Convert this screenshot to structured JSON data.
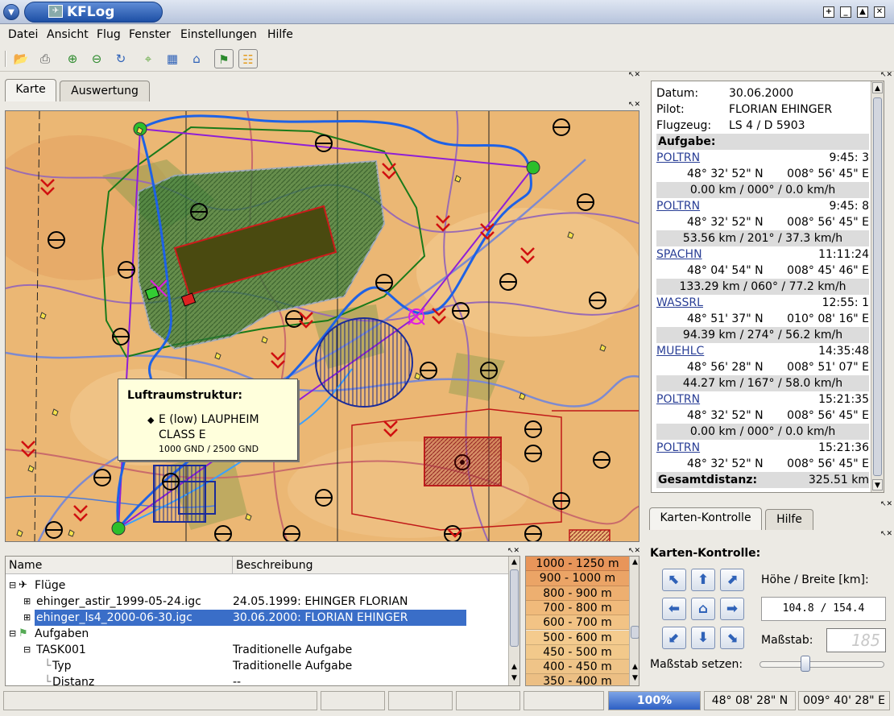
{
  "window": {
    "title": "KFLog"
  },
  "menu": [
    "Datei",
    "Ansicht",
    "Flug",
    "Fenster",
    "Einstellungen",
    "Hilfe"
  ],
  "tabs_main": [
    "Karte",
    "Auswertung"
  ],
  "tooltip": {
    "title": "Luftraumstruktur:",
    "line1": "E (low) LAUPHEIM",
    "line2": "CLASS E",
    "line3": "1000 GND / 2500 GND"
  },
  "flight_info": {
    "datum_label": "Datum:",
    "datum_value": "30.06.2000",
    "pilot_label": "Pilot:",
    "pilot_value": "FLORIAN EHINGER",
    "flugzeug_label": "Flugzeug:",
    "flugzeug_value": "LS 4 / D 5903",
    "aufgabe_label": "Aufgabe:",
    "waypoints": [
      {
        "name": "POLTRN",
        "time": "9:45: 3",
        "coords_n": "48° 32' 52\" N",
        "coords_e": "008° 56' 45\" E",
        "leg": "0.00 km / 000° / 0.0 km/h"
      },
      {
        "name": "POLTRN",
        "time": "9:45: 8",
        "coords_n": "48° 32' 52\" N",
        "coords_e": "008° 56' 45\" E",
        "leg": "53.56 km / 201° / 37.3 km/h"
      },
      {
        "name": "SPACHN",
        "time": "11:11:24",
        "coords_n": "48° 04' 54\" N",
        "coords_e": "008° 45' 46\" E",
        "leg": "133.29 km / 060° / 77.2 km/h"
      },
      {
        "name": "WASSRL",
        "time": "12:55: 1",
        "coords_n": "48° 51' 37\" N",
        "coords_e": "010° 08' 16\" E",
        "leg": "94.39 km / 274° / 56.2 km/h"
      },
      {
        "name": "MUEHLC",
        "time": "14:35:48",
        "coords_n": "48° 56' 28\" N",
        "coords_e": "008° 51' 07\" E",
        "leg": "44.27 km / 167° / 58.0 km/h"
      },
      {
        "name": "POLTRN",
        "time": "15:21:35",
        "coords_n": "48° 32' 52\" N",
        "coords_e": "008° 56' 45\" E",
        "leg": "0.00 km / 000° / 0.0 km/h"
      },
      {
        "name": "POLTRN",
        "time": "15:21:36",
        "coords_n": "48° 32' 52\" N",
        "coords_e": "008° 56' 45\" E",
        "leg": ""
      }
    ],
    "gesamt_label": "Gesamtdistanz:",
    "gesamt_value": "325.51 km"
  },
  "tabs_right": [
    "Karten-Kontrolle",
    "Hilfe"
  ],
  "tree": {
    "col_name": "Name",
    "col_desc": "Beschreibung",
    "rows": [
      {
        "name": "Flüge",
        "desc": ""
      },
      {
        "name": "ehinger_astir_1999-05-24.igc",
        "desc": "24.05.1999: EHINGER FLORIAN"
      },
      {
        "name": "ehinger_ls4_2000-06-30.igc",
        "desc": "30.06.2000: FLORIAN EHINGER"
      },
      {
        "name": "Aufgaben",
        "desc": ""
      },
      {
        "name": "TASK001",
        "desc": "Traditionelle Aufgabe"
      },
      {
        "name": "Typ",
        "desc": "Traditionelle Aufgabe"
      },
      {
        "name": "Distanz",
        "desc": "--"
      }
    ]
  },
  "legend": [
    {
      "label": "1000 - 1250 m",
      "color": "#e8955a"
    },
    {
      "label": "900 - 1000 m",
      "color": "#eba466"
    },
    {
      "label": "800 - 900 m",
      "color": "#edaf70"
    },
    {
      "label": "700 - 800 m",
      "color": "#f0ba7b"
    },
    {
      "label": "600 - 700 m",
      "color": "#f2c385"
    },
    {
      "label": "500 - 600 m",
      "color": "#f4cb8e"
    },
    {
      "label": "450 - 500 m",
      "color": "#f2c98b"
    },
    {
      "label": "400 - 450 m",
      "color": "#efc488"
    },
    {
      "label": "350 - 400 m",
      "color": "#ecbf84"
    }
  ],
  "karten_kontrolle": {
    "title": "Karten-Kontrolle:",
    "hoehe_label": "Höhe / Breite [km]:",
    "hoehe_value": "104.8 / 154.4",
    "massstab_label": "Maßstab:",
    "massstab_value": "185",
    "massstab_setzen_label": "Maßstab setzen:",
    "slider_fraction": 0.36
  },
  "status": {
    "progress": "100%",
    "lat": "48° 08' 28\" N",
    "lon": "009° 40' 28\" E"
  }
}
